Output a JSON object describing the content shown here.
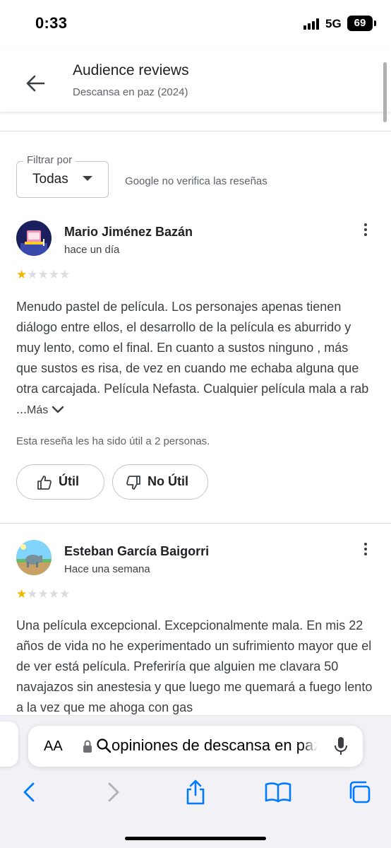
{
  "status_bar": {
    "time": "0:33",
    "network": "5G",
    "battery": "69"
  },
  "header": {
    "title": "Audience reviews",
    "subtitle": "Descansa en paz (2024)"
  },
  "filter": {
    "label": "Filtrar por",
    "value": "Todas",
    "note": "Google no verifica las reseñas"
  },
  "reviews": [
    {
      "name": "Mario Jiménez Bazán",
      "date": "hace un día",
      "rating": 1,
      "max_rating": 5,
      "text": "Menudo pastel de película. Los personajes apenas tienen diálogo entre ellos, el desarrollo de la película es aburrido y muy lento, como el final. En cuanto a sustos ninguno , más que sustos es risa, de vez en cuando me echaba alguna que otra carcajada. Película Nefasta. Cualquier película mala a rab ...",
      "more_label": "Más",
      "helpful_text": "Esta reseña les ha sido útil a 2 personas.",
      "helpful_button": "Útil",
      "not_helpful_button": "No Útil"
    },
    {
      "name": "Esteban García Baigorri",
      "date": "Hace una semana",
      "rating": 1,
      "max_rating": 5,
      "text": "Una película excepcional. Excepcionalmente mala. En mis 22 años de vida no he experimentado un sufrimiento mayor que el de ver está película. Preferiría que alguien me clavara 50 navajazos sin anestesia y que luego me quemará a fuego lento a la vez que me ahoga con gas"
    }
  ],
  "browser": {
    "text_size_label": "AA",
    "address": "opiniones de descansa en paz"
  },
  "icons": {
    "back": "arrow-left-icon",
    "overflow": "more-vertical-icon",
    "thumb_up": "thumb-up-icon",
    "thumb_down": "thumb-down-icon",
    "lock": "lock-icon",
    "search": "search-icon",
    "mic": "microphone-icon",
    "nav_back": "chevron-left-icon",
    "nav_forward": "chevron-right-icon",
    "share": "share-icon",
    "bookmarks": "book-icon",
    "tabs": "tabs-icon"
  },
  "colors": {
    "star_filled": "#f4b400",
    "star_empty": "#dadce0",
    "safari_blue": "#007aff",
    "text_primary": "#202124",
    "text_secondary": "#5f6368"
  }
}
